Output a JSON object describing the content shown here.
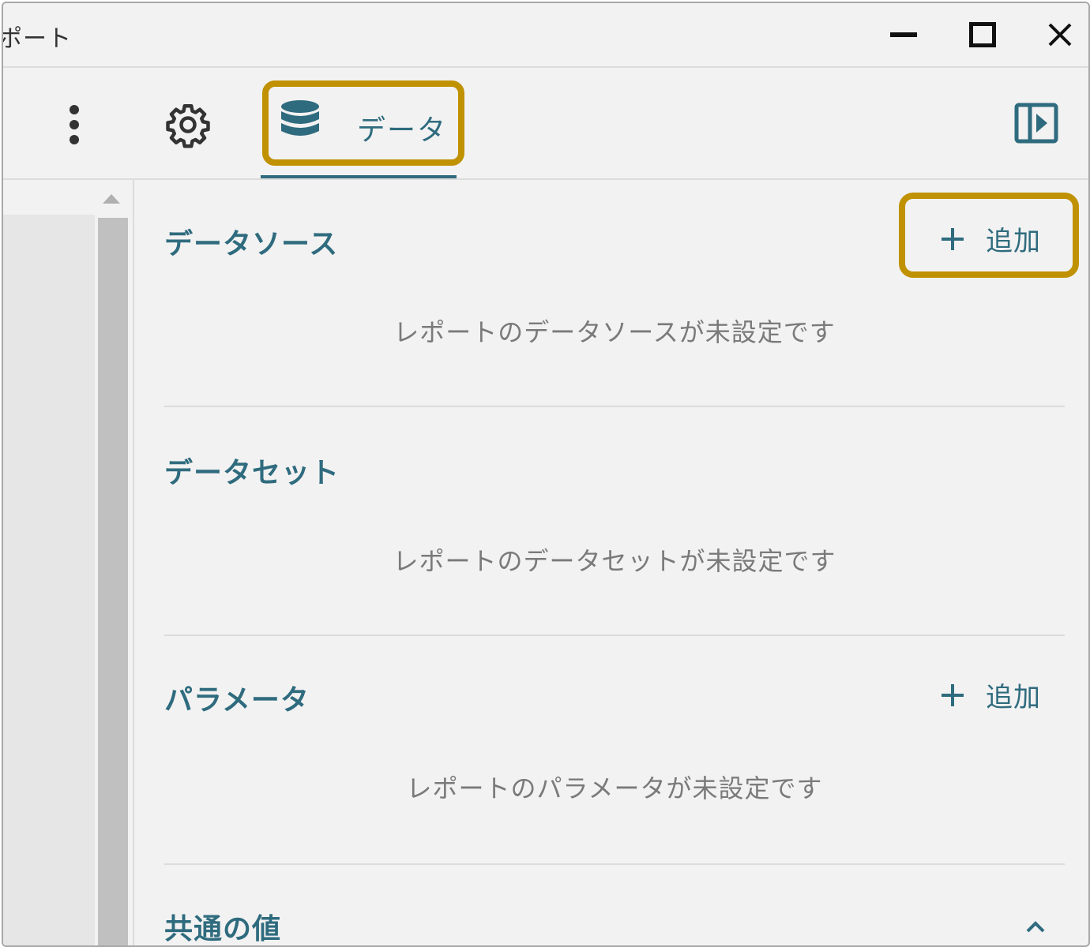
{
  "window": {
    "title": "ポート"
  },
  "toolbar": {
    "more_icon": "kebab-menu-icon",
    "settings_icon": "gear-icon",
    "data_tab_label": "データ",
    "data_tab_icon": "database-icon",
    "panel_toggle_icon": "panel-toggle-icon"
  },
  "sections": {
    "datasource": {
      "title": "データソース",
      "add_label": "追加",
      "empty_message": "レポートのデータソースが未設定です"
    },
    "dataset": {
      "title": "データセット",
      "empty_message": "レポートのデータセットが未設定です"
    },
    "parameters": {
      "title": "パラメータ",
      "add_label": "追加",
      "empty_message": "レポートのパラメータが未設定です"
    },
    "common": {
      "title": "共通の値"
    }
  },
  "colors": {
    "accent": "#2f6b7e",
    "highlight": "#c09100",
    "background": "#f2f2f2",
    "muted_text": "#7a7a7a"
  }
}
